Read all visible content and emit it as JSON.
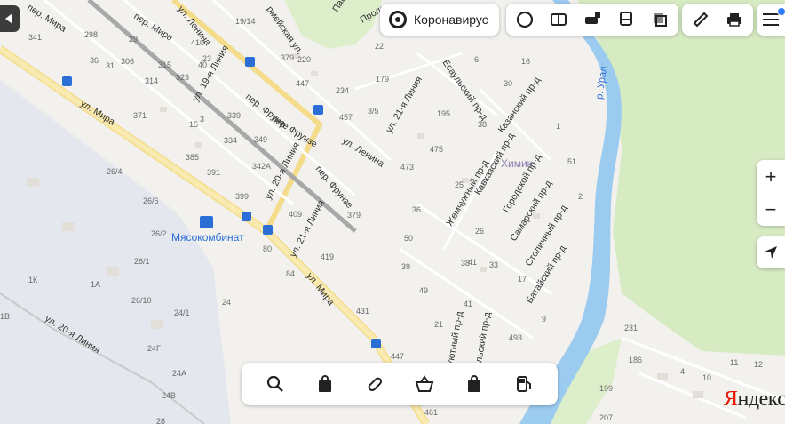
{
  "map": {
    "colors": {
      "background": "#f3f1ee",
      "river": "#9ccbf0",
      "forest": "#d9ecc4",
      "highway": "#f6e59a",
      "railway": "#a8a8a8",
      "industrial": "#e3e6ec"
    },
    "river_label": "р. Урал",
    "district_label": "Химик",
    "poi_label": "Мясокомбинат",
    "streets": [
      "пер. Мира",
      "пер. Мира",
      "ул. Мира",
      "ул. Мира",
      "ул. Ленина",
      "ул. Ленина",
      "ул. 19-я Линия",
      "пер. Фрунзе",
      "пер. Фрунзе",
      "пер. Фрунзе",
      "ул. 20-я Линия",
      "ул. 21-я Линия",
      "ул. 21-я Линия",
      "Есаульский пр-д",
      "Казанский пр-д",
      "Кавказский пр-д",
      "Жемчужный пр-д",
      "Городской пр-д",
      "Самарский пр-д",
      "Столичный пр-д",
      "Батайский пр-д",
      "Уютный пр-д",
      "ул. 20-я Линия",
      "Павл",
      "Пролет",
      "рмейская ул.",
      "Кальский пр-д",
      "ул. Ми"
    ],
    "house_numbers": [
      "341",
      "298",
      "36",
      "31",
      "306",
      "29",
      "315",
      "410",
      "23",
      "40",
      "19/14",
      "220",
      "314",
      "323",
      "379",
      "447",
      "371",
      "3",
      "339",
      "234",
      "179",
      "457",
      "3/5",
      "195",
      "15",
      "334",
      "349",
      "473",
      "475",
      "385",
      "391",
      "342А",
      "26/4",
      "399",
      "409",
      "379",
      "26/6",
      "26/2",
      "80",
      "84",
      "419",
      "1К",
      "1А",
      "26/1",
      "26/10",
      "1В",
      "24/1",
      "24",
      "24Г",
      "24А",
      "24В",
      "431",
      "447",
      "493",
      "461",
      "28",
      "186",
      "199",
      "207",
      "231",
      "25",
      "26",
      "36",
      "38",
      "39",
      "41",
      "41",
      "33",
      "49",
      "50",
      "21",
      "17",
      "9",
      "6",
      "16",
      "22",
      "38",
      "30",
      "1",
      "51",
      "2",
      "4",
      "10",
      "11",
      "12"
    ]
  },
  "header": {
    "corona_label": "Коронавирус",
    "layer_icons": [
      "traffic-icon",
      "panorama-icon",
      "parking-icon",
      "transit-icon",
      "layers-icon"
    ],
    "tool_icons": [
      "ruler-icon",
      "print-icon"
    ],
    "menu_icon": "hamburger-icon"
  },
  "controls": {
    "zoom_in": "+",
    "zoom_out": "−"
  },
  "categories": [
    "search-icon",
    "shopping-bag-icon",
    "pharmacy-icon",
    "supermarket-icon",
    "shopping-bag-icon",
    "gas-station-icon"
  ],
  "logo": {
    "y": "Я",
    "rest": "ндекс"
  }
}
